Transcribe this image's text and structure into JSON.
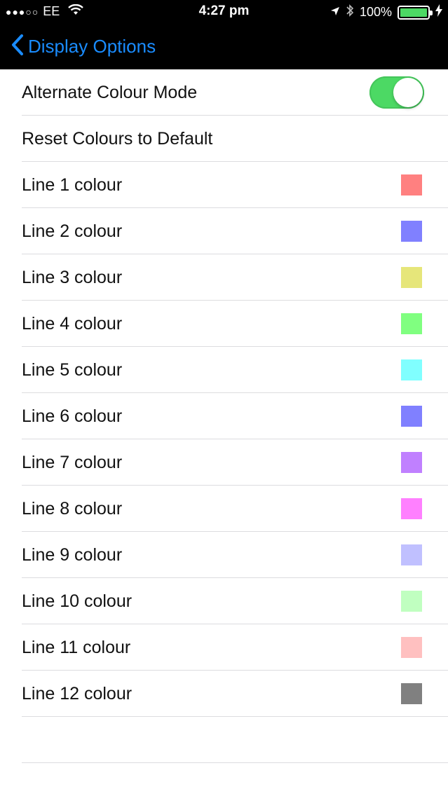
{
  "status_bar": {
    "signal": "●●●○○",
    "carrier": "EE",
    "time": "4:27 pm",
    "battery": "100%",
    "battery_color": "#4cd964"
  },
  "nav": {
    "back_label": "Display Options",
    "accent_color": "#1a8cff"
  },
  "settings": {
    "alternate_colour_mode": {
      "label": "Alternate Colour Mode",
      "enabled": true,
      "toggle_color": "#4cd964"
    },
    "reset_label": "Reset Colours to Default",
    "lines": [
      {
        "label": "Line 1 colour",
        "color": "#ff8080"
      },
      {
        "label": "Line 2 colour",
        "color": "#8080ff"
      },
      {
        "label": "Line 3 colour",
        "color": "#e6e67a"
      },
      {
        "label": "Line 4 colour",
        "color": "#80ff80"
      },
      {
        "label": "Line 5 colour",
        "color": "#80ffff"
      },
      {
        "label": "Line 6 colour",
        "color": "#8080ff"
      },
      {
        "label": "Line 7 colour",
        "color": "#c080ff"
      },
      {
        "label": "Line 8 colour",
        "color": "#ff80ff"
      },
      {
        "label": "Line 9 colour",
        "color": "#c0c0ff"
      },
      {
        "label": "Line 10 colour",
        "color": "#c0ffc0"
      },
      {
        "label": "Line 11 colour",
        "color": "#ffc0c0"
      },
      {
        "label": "Line 12 colour",
        "color": "#808080"
      }
    ]
  }
}
